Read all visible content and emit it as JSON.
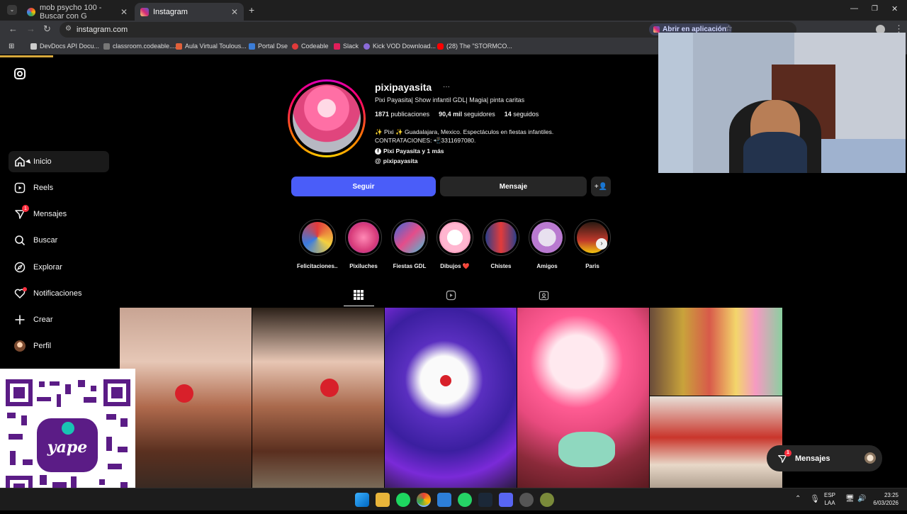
{
  "browser": {
    "tabs": [
      {
        "title": "mob psycho 100 - Buscar con G",
        "active": false
      },
      {
        "title": "Instagram",
        "active": true
      }
    ],
    "new_tab_label": "+",
    "url": "instagram.com",
    "open_app_label": "Abrir en aplicación",
    "bookmarks": [
      "DevDocs API Docu...",
      "classroom.codeable....",
      "Aula Virtual Toulous...",
      "Portal Dse",
      "Codeable",
      "Slack",
      "Kick VOD Download...",
      "(28) The \"STORMCO..."
    ]
  },
  "sidebar": {
    "items": [
      {
        "label": "Inicio",
        "icon": "home-icon"
      },
      {
        "label": "Reels",
        "icon": "reels-icon"
      },
      {
        "label": "Mensajes",
        "icon": "messenger-icon",
        "badge": "1"
      },
      {
        "label": "Buscar",
        "icon": "search-icon"
      },
      {
        "label": "Explorar",
        "icon": "compass-icon"
      },
      {
        "label": "Notificaciones",
        "icon": "heart-icon"
      },
      {
        "label": "Crear",
        "icon": "plus-icon"
      },
      {
        "label": "Perfil",
        "icon": "avatar"
      }
    ]
  },
  "profile": {
    "username": "pixipayasita",
    "more": "···",
    "full_name": "Pixi Payasita| Show infantil GDL| Magia| pinta caritas",
    "posts": "1871",
    "posts_label": "publicaciones",
    "followers": "90,4 mil",
    "followers_label": "seguidores",
    "following": "14",
    "following_label": "seguidos",
    "bio_line1": "✨ Pixi ✨ Guadalajara, Mexico. Espectáculos en fiestas infantiles.",
    "bio_line2": "CONTRATACIONES: 📲3311697080.",
    "facebook_link": "Pixi Payasita y 1 más",
    "threads_link": "pixipayasita",
    "follow_btn": "Seguir",
    "message_btn": "Mensaje"
  },
  "highlights": [
    {
      "label": "Felicitaciones..."
    },
    {
      "label": "Pixiluches"
    },
    {
      "label": "Fiestas GDL"
    },
    {
      "label": "Dibujos ❤️"
    },
    {
      "label": "Chistes"
    },
    {
      "label": "Amigos"
    },
    {
      "label": "Paris"
    }
  ],
  "messages_pill": {
    "label": "Mensajes",
    "badge": "1"
  },
  "taskbar": {
    "lang1": "ESP",
    "lang2": "LAA",
    "time": "23:25",
    "date": "6/03/2026"
  },
  "colors": {
    "follow_button": "#4a5df9",
    "notification_badge": "#ff3040",
    "background": "#000000"
  }
}
